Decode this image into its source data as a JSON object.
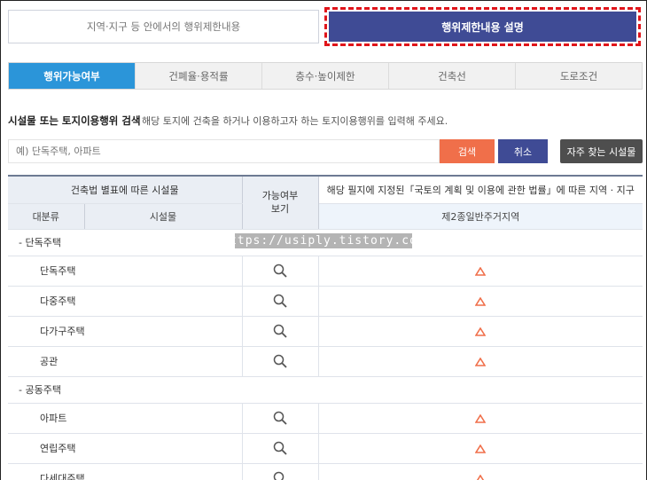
{
  "top_tabs": {
    "left_label": "지역·지구 등 안에서의 행위제한내용",
    "right_label": "행위제한내용 설명"
  },
  "sub_tabs": [
    {
      "label": "행위가능여부",
      "active": true
    },
    {
      "label": "건폐율·용적률",
      "active": false
    },
    {
      "label": "층수·높이제한",
      "active": false
    },
    {
      "label": "건축선",
      "active": false
    },
    {
      "label": "도로조건",
      "active": false
    }
  ],
  "search": {
    "title": "시설물 또는 토지이용행위 검색",
    "description": "해당 토지에 건축을 하거나 이용하고자 하는 토지이용행위를 입력해 주세요.",
    "placeholder": "예) 단독주택, 아파트",
    "value": "",
    "search_button": "검색",
    "cancel_button": "취소",
    "favorites_button": "자주 찾는 시설물"
  },
  "table": {
    "header_left": "건축법 별표에 따른 시설물",
    "header_col1": "대분류",
    "header_col2": "시설물",
    "header_avail_line1": "가능여부",
    "header_avail_line2": "보기",
    "header_right": "해당 필지에 지정된「국토의 계획 및 이용에 관한 법률」에 따른 지역 · 지구",
    "zone_name": "제2종일반주거지역",
    "groups": [
      {
        "label": "- 단독주택",
        "items": [
          {
            "name": "단독주택",
            "status": "conditional"
          },
          {
            "name": "다중주택",
            "status": "conditional"
          },
          {
            "name": "다가구주택",
            "status": "conditional"
          },
          {
            "name": "공관",
            "status": "conditional"
          }
        ]
      },
      {
        "label": "- 공동주택",
        "items": [
          {
            "name": "아파트",
            "status": "conditional"
          },
          {
            "name": "연립주택",
            "status": "conditional"
          },
          {
            "name": "다세대주택",
            "status": "conditional"
          }
        ]
      }
    ]
  },
  "icons": {
    "view": "magnifier-icon",
    "conditional": "triangle-icon"
  },
  "colors": {
    "accent_blue": "#2b95d9",
    "navy": "#3f4b95",
    "orange": "#f06f4a",
    "highlight_border": "#e0141a",
    "triangle": "#f06f4a"
  },
  "watermark": "https://usiply.tistory.com"
}
